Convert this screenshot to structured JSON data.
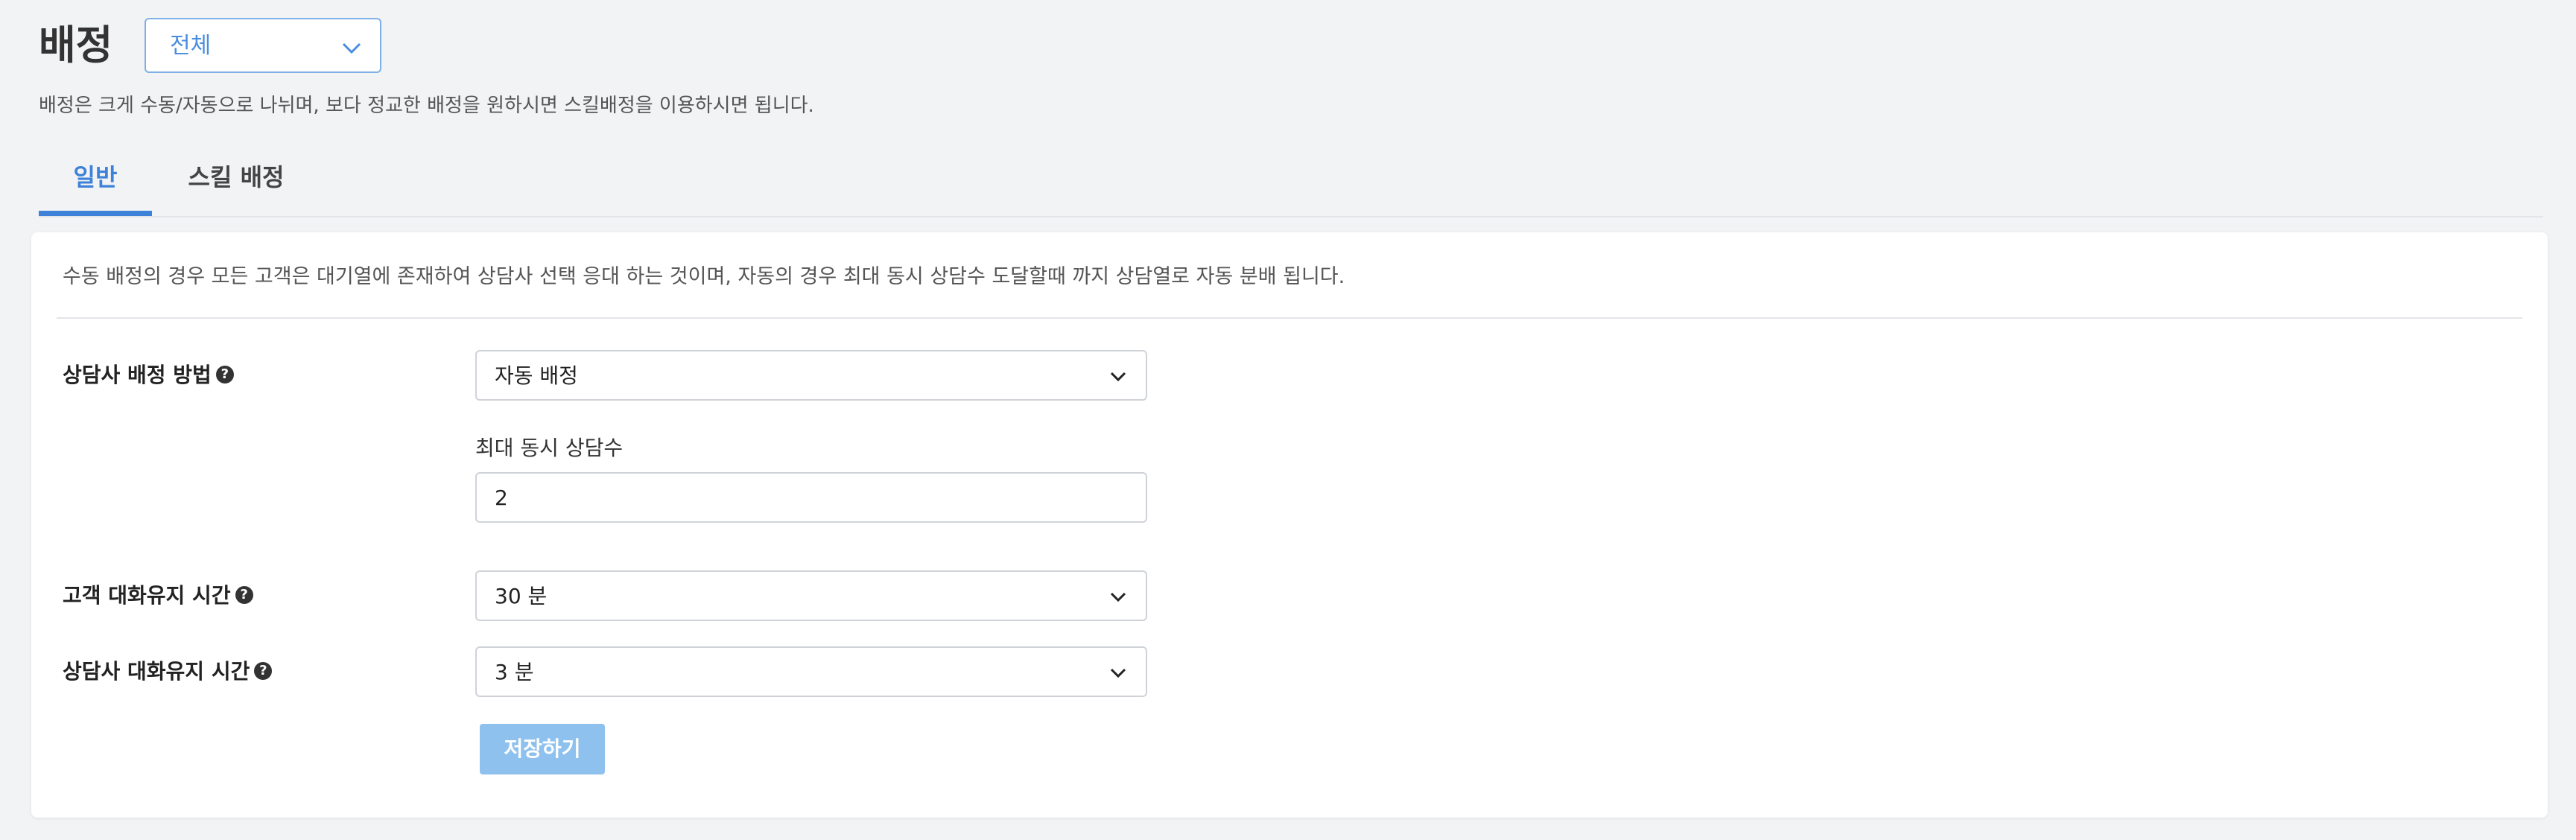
{
  "header": {
    "title": "배정",
    "scope_select": {
      "value": "전체"
    },
    "description": "배정은 크게 수동/자동으로 나뉘며, 보다 정교한 배정을 원하시면 스킬배정을 이용하시면 됩니다."
  },
  "tabs": [
    {
      "label": "일반",
      "active": true
    },
    {
      "label": "스킬 배정",
      "active": false
    }
  ],
  "card": {
    "description": "수동 배정의 경우 모든 고객은 대기열에 존재하여 상담사 선택 응대 하는 것이며, 자동의 경우 최대 동시 상담수 도달할때 까지 상담열로 자동 분배 됩니다.",
    "assignment_method": {
      "label": "상담사 배정 방법",
      "value": "자동 배정"
    },
    "max_concurrent": {
      "label": "최대 동시 상담수",
      "value": "2"
    },
    "customer_keepalive": {
      "label": "고객 대화유지 시간",
      "value": "30 분"
    },
    "agent_keepalive": {
      "label": "상담사 대화유지 시간",
      "value": "3 분"
    },
    "save_label": "저장하기"
  },
  "colors": {
    "accent": "#3d82d8",
    "save_button": "#8fc1ee",
    "background": "#f2f3f5"
  },
  "icons": [
    "chevron-down-icon",
    "help-icon"
  ]
}
